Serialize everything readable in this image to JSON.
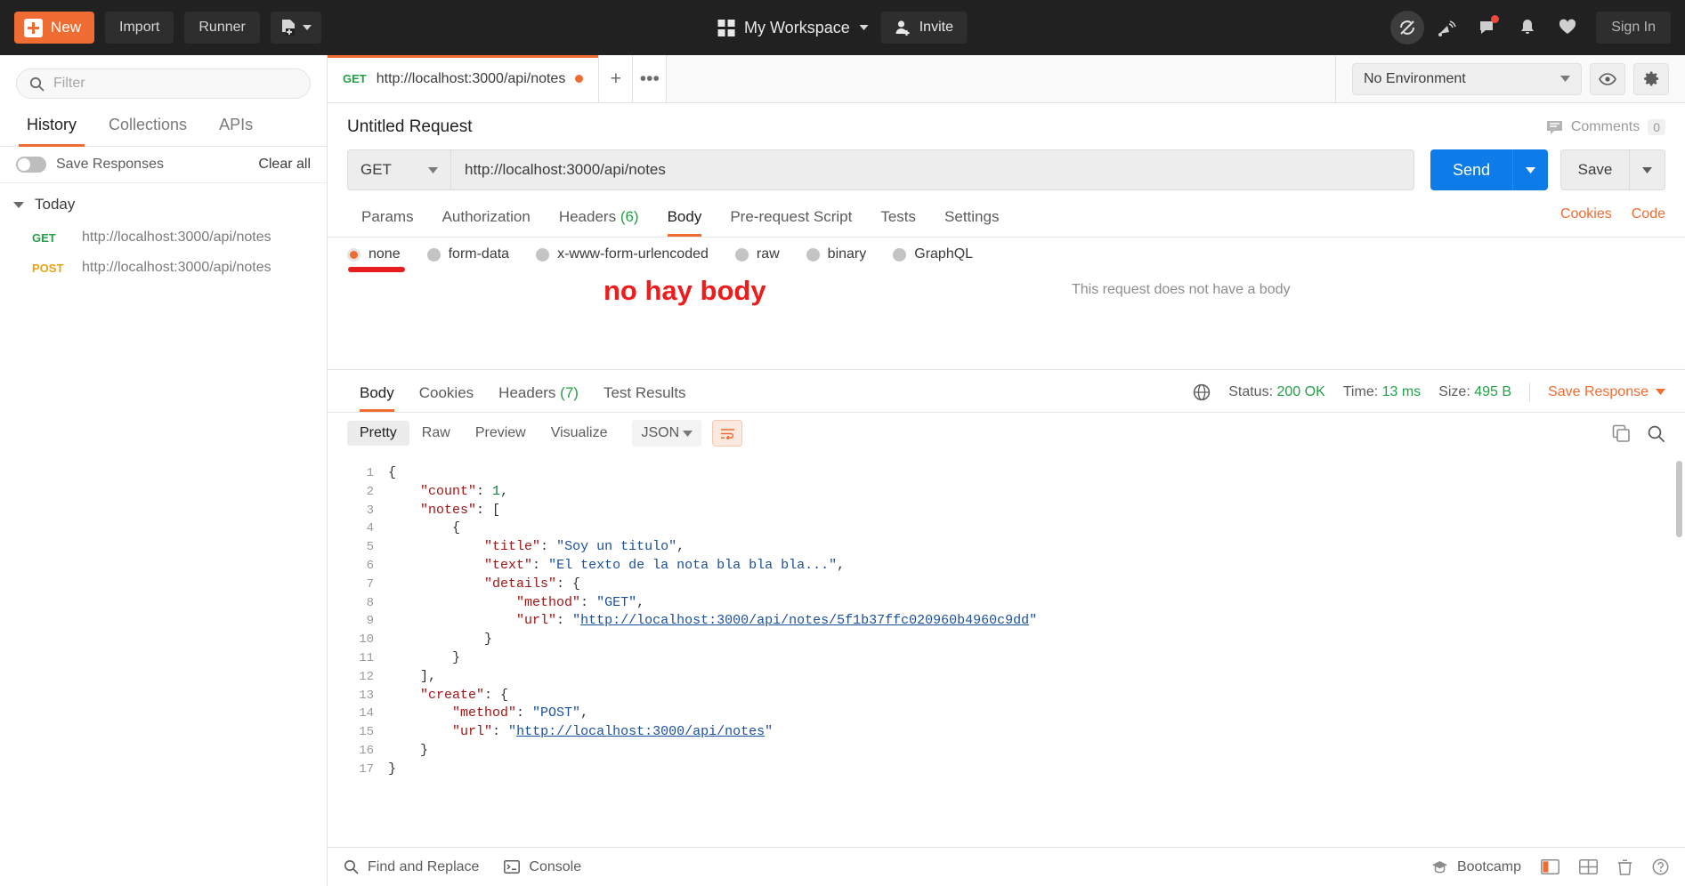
{
  "topbar": {
    "new_label": "New",
    "import_label": "Import",
    "runner_label": "Runner",
    "workspace_label": "My Workspace",
    "invite_label": "Invite",
    "signin_label": "Sign In"
  },
  "sidebar": {
    "filter_placeholder": "Filter",
    "tabs": [
      {
        "label": "History",
        "active": true
      },
      {
        "label": "Collections",
        "active": false
      },
      {
        "label": "APIs",
        "active": false
      }
    ],
    "save_responses_label": "Save Responses",
    "clear_all_label": "Clear all",
    "group_label": "Today",
    "history": [
      {
        "method": "GET",
        "url": "http://localhost:3000/api/notes"
      },
      {
        "method": "POST",
        "url": "http://localhost:3000/api/notes"
      }
    ]
  },
  "tabstrip": {
    "tab_method": "GET",
    "tab_url": "http://localhost:3000/api/notes",
    "plus_label": "+",
    "more_label": "•••",
    "environment": "No Environment"
  },
  "request": {
    "title": "Untitled Request",
    "comments_label": "Comments",
    "comments_count": "0",
    "method": "GET",
    "url": "http://localhost:3000/api/notes",
    "send_label": "Send",
    "save_label": "Save",
    "tabs": [
      {
        "label": "Params",
        "count": "",
        "active": false
      },
      {
        "label": "Authorization",
        "count": "",
        "active": false
      },
      {
        "label": "Headers",
        "count": "(6)",
        "active": false
      },
      {
        "label": "Body",
        "count": "",
        "active": true
      },
      {
        "label": "Pre-request Script",
        "count": "",
        "active": false
      },
      {
        "label": "Tests",
        "count": "",
        "active": false
      },
      {
        "label": "Settings",
        "count": "",
        "active": false
      }
    ],
    "cookies_link": "Cookies",
    "code_link": "Code",
    "body_types": [
      {
        "label": "none",
        "selected": true
      },
      {
        "label": "form-data",
        "selected": false
      },
      {
        "label": "x-www-form-urlencoded",
        "selected": false
      },
      {
        "label": "raw",
        "selected": false
      },
      {
        "label": "binary",
        "selected": false
      },
      {
        "label": "GraphQL",
        "selected": false
      }
    ],
    "no_body_message": "This request does not have a body",
    "annotation_text": "no hay body",
    "annotation_color": "#ee1c1c"
  },
  "response": {
    "tabs": [
      {
        "label": "Body",
        "count": "",
        "active": true
      },
      {
        "label": "Cookies",
        "count": "",
        "active": false
      },
      {
        "label": "Headers",
        "count": "(7)",
        "active": false
      },
      {
        "label": "Test Results",
        "count": "",
        "active": false
      }
    ],
    "status_label": "Status:",
    "status_value": "200 OK",
    "time_label": "Time:",
    "time_value": "13 ms",
    "size_label": "Size:",
    "size_value": "495 B",
    "save_response_label": "Save Response",
    "view_tabs": [
      {
        "label": "Pretty",
        "active": true
      },
      {
        "label": "Raw",
        "active": false
      },
      {
        "label": "Preview",
        "active": false
      },
      {
        "label": "Visualize",
        "active": false
      }
    ],
    "format": "JSON",
    "line_numbers": [
      "1",
      "2",
      "3",
      "4",
      "5",
      "6",
      "7",
      "8",
      "9",
      "10",
      "11",
      "12",
      "13",
      "14",
      "15",
      "16",
      "17"
    ],
    "body_lines": [
      [
        {
          "t": "{",
          "c": "p"
        }
      ],
      [
        {
          "t": "    ",
          "c": "p"
        },
        {
          "t": "\"count\"",
          "c": "k"
        },
        {
          "t": ": ",
          "c": "p"
        },
        {
          "t": "1",
          "c": "n"
        },
        {
          "t": ",",
          "c": "p"
        }
      ],
      [
        {
          "t": "    ",
          "c": "p"
        },
        {
          "t": "\"notes\"",
          "c": "k"
        },
        {
          "t": ": [",
          "c": "p"
        }
      ],
      [
        {
          "t": "        {",
          "c": "p"
        }
      ],
      [
        {
          "t": "            ",
          "c": "p"
        },
        {
          "t": "\"title\"",
          "c": "k"
        },
        {
          "t": ": ",
          "c": "p"
        },
        {
          "t": "\"Soy un titulo\"",
          "c": "s"
        },
        {
          "t": ",",
          "c": "p"
        }
      ],
      [
        {
          "t": "            ",
          "c": "p"
        },
        {
          "t": "\"text\"",
          "c": "k"
        },
        {
          "t": ": ",
          "c": "p"
        },
        {
          "t": "\"El texto de la nota bla bla bla...\"",
          "c": "s"
        },
        {
          "t": ",",
          "c": "p"
        }
      ],
      [
        {
          "t": "            ",
          "c": "p"
        },
        {
          "t": "\"details\"",
          "c": "k"
        },
        {
          "t": ": {",
          "c": "p"
        }
      ],
      [
        {
          "t": "                ",
          "c": "p"
        },
        {
          "t": "\"method\"",
          "c": "k"
        },
        {
          "t": ": ",
          "c": "p"
        },
        {
          "t": "\"GET\"",
          "c": "s"
        },
        {
          "t": ",",
          "c": "p"
        }
      ],
      [
        {
          "t": "                ",
          "c": "p"
        },
        {
          "t": "\"url\"",
          "c": "k"
        },
        {
          "t": ": ",
          "c": "p"
        },
        {
          "t": "\"",
          "c": "s"
        },
        {
          "t": "http://localhost:3000/api/notes/5f1b37ffc020960b4960c9dd",
          "c": "lnk"
        },
        {
          "t": "\"",
          "c": "s"
        }
      ],
      [
        {
          "t": "            }",
          "c": "p"
        }
      ],
      [
        {
          "t": "        }",
          "c": "p"
        }
      ],
      [
        {
          "t": "    ],",
          "c": "p"
        }
      ],
      [
        {
          "t": "    ",
          "c": "p"
        },
        {
          "t": "\"create\"",
          "c": "k"
        },
        {
          "t": ": {",
          "c": "p"
        }
      ],
      [
        {
          "t": "        ",
          "c": "p"
        },
        {
          "t": "\"method\"",
          "c": "k"
        },
        {
          "t": ": ",
          "c": "p"
        },
        {
          "t": "\"POST\"",
          "c": "s"
        },
        {
          "t": ",",
          "c": "p"
        }
      ],
      [
        {
          "t": "        ",
          "c": "p"
        },
        {
          "t": "\"url\"",
          "c": "k"
        },
        {
          "t": ": ",
          "c": "p"
        },
        {
          "t": "\"",
          "c": "s"
        },
        {
          "t": "http://localhost:3000/api/notes",
          "c": "lnk"
        },
        {
          "t": "\"",
          "c": "s"
        }
      ],
      [
        {
          "t": "    }",
          "c": "p"
        }
      ],
      [
        {
          "t": "}",
          "c": "p"
        }
      ]
    ]
  },
  "footer": {
    "find_replace_label": "Find and Replace",
    "console_label": "Console",
    "bootcamp_label": "Bootcamp"
  },
  "colors": {
    "accent_orange": "#ef6c33",
    "send_blue": "#0d7ce8",
    "status_green": "#24a148",
    "post_yellow": "#e8a317",
    "annotation_red": "#ee1c1c"
  }
}
